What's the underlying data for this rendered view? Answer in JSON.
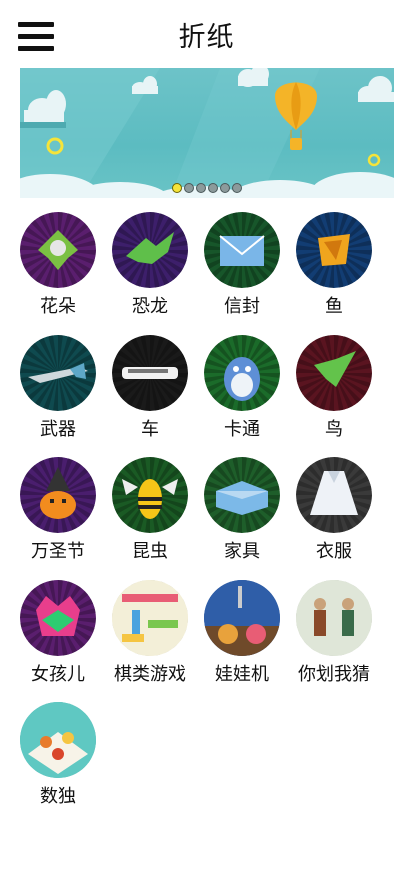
{
  "header": {
    "title": "折纸",
    "menu_icon": "hamburger-menu-icon"
  },
  "banner": {
    "pages": 6,
    "active_page": 1
  },
  "categories": [
    {
      "label": "花朵",
      "icon": "flower-icon",
      "bg": "#5a1e6e",
      "fg": "#7bc043"
    },
    {
      "label": "恐龙",
      "icon": "dinosaur-icon",
      "bg": "#3d1f6b",
      "fg": "#5fbf4a"
    },
    {
      "label": "信封",
      "icon": "envelope-icon",
      "bg": "#17562a",
      "fg": "#7ab6e8"
    },
    {
      "label": "鱼",
      "icon": "fish-icon",
      "bg": "#123d73",
      "fg": "#f0a51e"
    },
    {
      "label": "武器",
      "icon": "weapon-icon",
      "bg": "#0f4a4f",
      "fg": "#cfd8dc"
    },
    {
      "label": "车",
      "icon": "car-icon",
      "bg": "#1a1a1a",
      "fg": "#f2f2f2"
    },
    {
      "label": "卡通",
      "icon": "cartoon-icon",
      "bg": "#1b6b2a",
      "fg": "#5e8fd6"
    },
    {
      "label": "鸟",
      "icon": "bird-icon",
      "bg": "#5a1420",
      "fg": "#63c34b"
    },
    {
      "label": "万圣节",
      "icon": "halloween-icon",
      "bg": "#4a1e6e",
      "fg": "#f28c1e"
    },
    {
      "label": "昆虫",
      "icon": "insect-icon",
      "bg": "#1a5a24",
      "fg": "#f5c518"
    },
    {
      "label": "家具",
      "icon": "furniture-icon",
      "bg": "#1e5e2a",
      "fg": "#7cb9e8"
    },
    {
      "label": "衣服",
      "icon": "clothes-icon",
      "bg": "#3a3a3a",
      "fg": "#eef2f7"
    },
    {
      "label": "女孩儿",
      "icon": "girl-icon",
      "bg": "#5a1e6e",
      "fg": "#e83e8c"
    },
    {
      "label": "棋类游戏",
      "icon": "board-game-icon",
      "bg": "#f3efd8",
      "fg": "#e85d75"
    },
    {
      "label": "娃娃机",
      "icon": "claw-machine-icon",
      "bg": "#2f5ea8",
      "fg": "#e8a23c"
    },
    {
      "label": "你划我猜",
      "icon": "draw-guess-icon",
      "bg": "#dfe6d8",
      "fg": "#3a6b4a"
    },
    {
      "label": "数独",
      "icon": "sudoku-icon",
      "bg": "#5fc8c2",
      "fg": "#f5c542"
    }
  ]
}
